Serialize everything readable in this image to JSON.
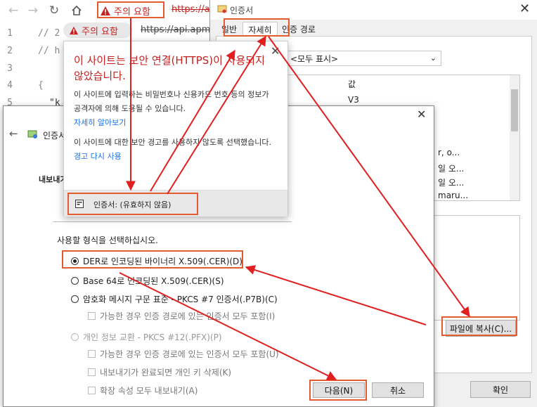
{
  "browser": {
    "warning_label": "주의 요함",
    "url_scheme": "https://",
    "url_text": "https://a"
  },
  "editor": {
    "lines": [
      {
        "num": "1",
        "text": "// 2"
      },
      {
        "num": "2",
        "text": "// h"
      },
      {
        "num": "3",
        "text": ""
      },
      {
        "num": "4",
        "text": "{"
      },
      {
        "num": "5",
        "text": "\"k"
      },
      {
        "num": "6",
        "text": ""
      }
    ],
    "warning_label": "주의 요함",
    "url_text": "https://api.apm"
  },
  "popup": {
    "title": "이 사이트는 보안 연결(HTTPS)이 사용되지 않았습니다.",
    "body1": "이 사이트에 입력하는 비밀번호나 신용카드 번호 등의 정보가 공격자에 의해 도용될 수 있습니다.",
    "learn_more": "자세히 알아보기",
    "body2": "이 사이트에 대한 보안 경고를 사용하지 않도록 선택했습니다.",
    "rewarn_link": "경고 다시 사용",
    "cert_row": "인증서: (유효하지 않음)"
  },
  "cert_window": {
    "title": "인증서",
    "tabs": [
      "일반",
      "자세히",
      "인증 경로"
    ],
    "show_select": "<모두 표시>",
    "value_header": "값",
    "values": [
      "V3",
      "",
      "",
      "r, o...",
      "일 오...",
      "일 오...",
      "maru..."
    ],
    "copy_button": "파일에 복사(C)...",
    "ok_button": "확인"
  },
  "wizard": {
    "title": "인증서 내보내기 마법사",
    "header_label": "내보내기 파일 형식",
    "prompt": "사용할 형식을 선택하십시오.",
    "options": [
      {
        "label": "DER로 인코딩된 바이너리 X.509(.CER)(D)"
      },
      {
        "label": "Base 64로 인코딩된 X.509(.CER)(S)"
      },
      {
        "label": "암호화 메시지 구문 표준 - PKCS #7 인증서(.P7B)(C)"
      },
      {
        "label": "가능한 경우 인증 경로에 있는 인증서 모두 포함(I)"
      },
      {
        "label": "개인 정보 교환 - PKCS #12(.PFX)(P)"
      },
      {
        "label": "가능한 경우 인증 경로에 있는 인증서 모두 포함(U)"
      },
      {
        "label": "내보내기가 완료되면 개인 키 삭제(K)"
      },
      {
        "label": "확장 속성 모두 내보내기(A)"
      }
    ],
    "next_button": "다음(N)",
    "cancel_button": "취소"
  },
  "colors": {
    "warning_red": "#c5221f",
    "highlight": "#e35b2e",
    "arrow": "#e02020",
    "link_blue": "#1a73e8"
  }
}
